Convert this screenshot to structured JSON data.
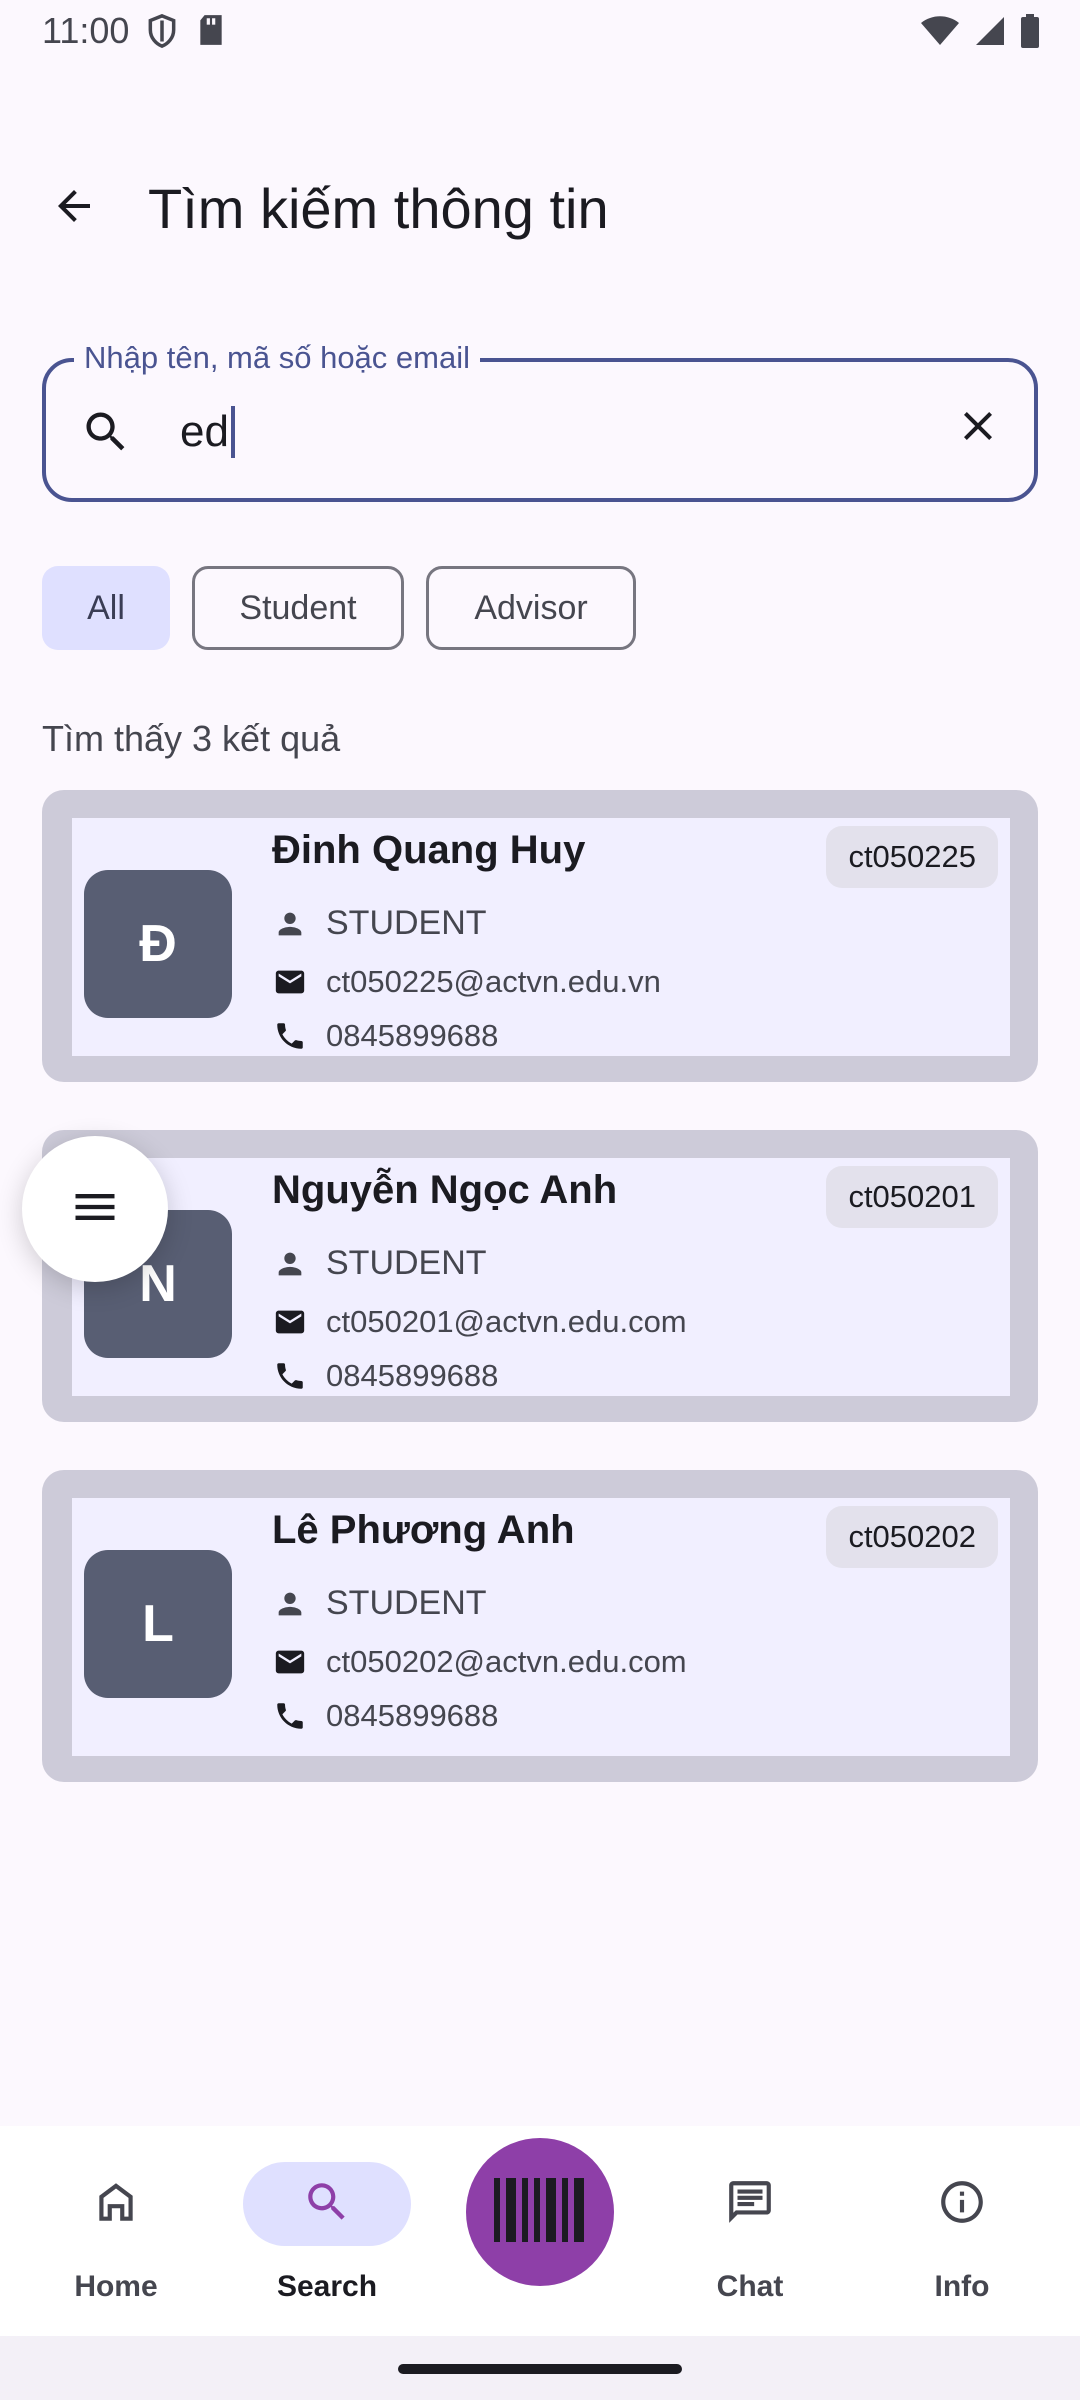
{
  "status_bar": {
    "time": "11:00"
  },
  "header": {
    "title": "Tìm kiếm thông tin"
  },
  "search": {
    "label": "Nhập tên, mã số hoặc email",
    "value": "ed"
  },
  "filters": {
    "chips": [
      {
        "label": "All",
        "selected": true
      },
      {
        "label": "Student",
        "selected": false
      },
      {
        "label": "Advisor",
        "selected": false
      }
    ]
  },
  "results": {
    "count_text": "Tìm thấy 3 kết quả",
    "items": [
      {
        "initial": "Đ",
        "name": "Đinh Quang Huy",
        "code": "ct050225",
        "role": "STUDENT",
        "email": "ct050225@actvn.edu.vn",
        "phone": "0845899688"
      },
      {
        "initial": "N",
        "name": "Nguyễn Ngọc Anh",
        "code": "ct050201",
        "role": "STUDENT",
        "email": "ct050201@actvn.edu.com",
        "phone": "0845899688"
      },
      {
        "initial": "L",
        "name": "Lê Phương Anh",
        "code": "ct050202",
        "role": "STUDENT",
        "email": "ct050202@actvn.edu.com",
        "phone": "0845899688"
      }
    ]
  },
  "bottom_nav": {
    "items": [
      {
        "label": "Home",
        "icon": "home-icon",
        "active": false
      },
      {
        "label": "Search",
        "icon": "search-icon",
        "active": true
      },
      {
        "label": "Chat",
        "icon": "chat-icon",
        "active": false
      },
      {
        "label": "Info",
        "icon": "info-icon",
        "active": false
      }
    ],
    "scan_icon": "barcode-icon"
  },
  "colors": {
    "primary": "#4a5491",
    "scan_button": "#8e3fa8",
    "avatar": "#585e73",
    "chip_selected": "#dfe0ff"
  }
}
